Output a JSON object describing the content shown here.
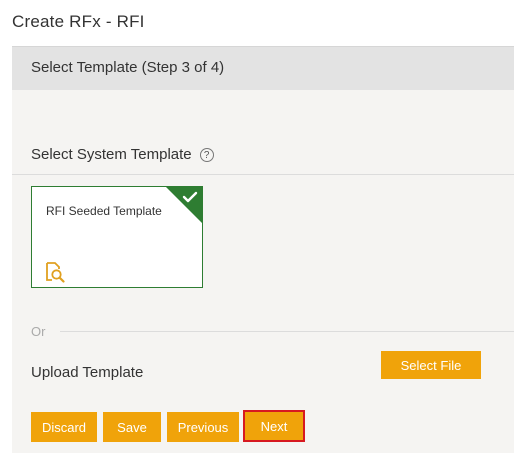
{
  "page": {
    "title": "Create RFx - RFI"
  },
  "step": {
    "title": "Select Template (Step 3 of 4)"
  },
  "system_template": {
    "heading": "Select System Template",
    "help_icon": "?",
    "card": {
      "label": "RFI Seeded Template",
      "selected": true,
      "preview_icon": "document-search-icon",
      "check_icon": "checkmark-icon"
    }
  },
  "separator": {
    "or_label": "Or"
  },
  "upload": {
    "heading": "Upload Template",
    "select_file_label": "Select File"
  },
  "actions": {
    "discard_label": "Discard",
    "save_label": "Save",
    "previous_label": "Previous",
    "next_label": "Next"
  },
  "colors": {
    "accent": "#f0a30a",
    "selected_border": "#2e7d32",
    "highlight": "#d71920",
    "panel_bg": "#f5f4f2",
    "header_bg": "#e3e3e3"
  }
}
